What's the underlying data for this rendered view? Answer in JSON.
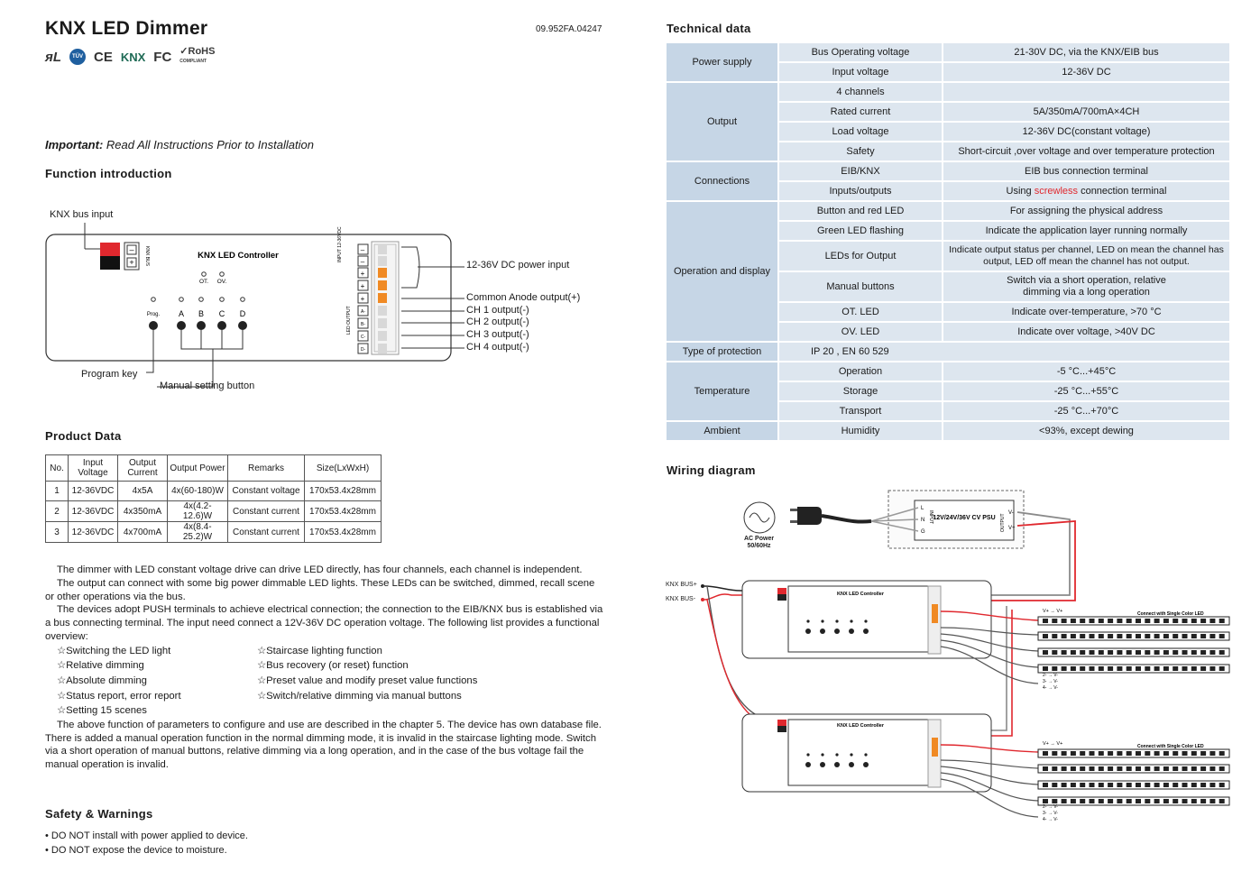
{
  "header": {
    "title": "KNX LED Dimmer",
    "doc_number": "09.952FA.04247",
    "certs": [
      "UL",
      "TÜV",
      "CE",
      "KNX",
      "FC",
      "RoHS"
    ]
  },
  "important": {
    "label": "Important:",
    "text": "Read All Instructions Prior to Installation"
  },
  "function_intro": {
    "heading": "Function introduction",
    "knx_bus_input": "KNX bus input",
    "controller_title": "KNX LED Controller",
    "ot": "OT.",
    "ov": "OV.",
    "prog": "Prog.",
    "buttons": [
      "A",
      "B",
      "C",
      "D"
    ],
    "power_input": "12-36V DC power input",
    "common_anode": "Common Anode output(+)",
    "ch_outputs": [
      "CH 1 output(-)",
      "CH 2 output(-)",
      "CH 3 output(-)",
      "CH 4 output(-)"
    ],
    "program_key": "Program key",
    "manual_button": "Manual setting button",
    "knx_bus_side": "KNX BUS",
    "input_side": "INPUT 12-36VDC",
    "led_output_side": "LED OUTPUT",
    "term_out": [
      "A-",
      "B-",
      "C-",
      "D-"
    ]
  },
  "product_data": {
    "heading": "Product Data",
    "columns": [
      "No.",
      "Input Voltage",
      "Output Current",
      "Output Power",
      "Remarks",
      "Size(LxWxH)"
    ],
    "rows": [
      [
        "1",
        "12-36VDC",
        "4x5A",
        "4x(60-180)W",
        "Constant voltage",
        "170x53.4x28mm"
      ],
      [
        "2",
        "12-36VDC",
        "4x350mA",
        "4x(4.2-12.6)W",
        "Constant current",
        "170x53.4x28mm"
      ],
      [
        "3",
        "12-36VDC",
        "4x700mA",
        "4x(8.4-25.2)W",
        "Constant current",
        "170x53.4x28mm"
      ]
    ]
  },
  "description": {
    "p1": "The dimmer with LED constant voltage drive can drive LED directly, has four channels, each channel is independent.",
    "p2": "The output can connect with some big power dimmable LED lights. These LEDs can be switched, dimmed, recall scene or other operations via the bus.",
    "p3": "The devices adopt PUSH terminals to achieve electrical connection; the connection to the EIB/KNX bus is established via a bus connecting terminal. The input need connect a 12V-36V DC operation voltage. The following list provides a functional overview:",
    "features": [
      "☆Switching the LED light",
      "☆Staircase lighting function",
      "☆Relative dimming",
      "☆Bus recovery (or reset) function",
      "☆Absolute dimming",
      "☆Preset value and modify preset value functions",
      "☆Status report, error report",
      "☆Switch/relative dimming via manual buttons",
      "☆Setting 15 scenes",
      ""
    ],
    "p4": "The above function of parameters to configure and use are described in the chapter 5. The device has own database file. There is added a manual operation function in the normal dimming mode, it is invalid in the staircase lighting mode. Switch via a short operation of manual buttons, relative dimming via a long operation, and in the case of the bus voltage fail the manual operation is invalid."
  },
  "safety": {
    "heading": "Safety & Warnings",
    "items": [
      "• DO NOT install with power applied to device.",
      "• DO NOT expose the device to moisture."
    ]
  },
  "technical": {
    "heading": "Technical data",
    "groups": [
      {
        "category": "Power supply",
        "rows": [
          [
            "Bus Operating voltage",
            "21-30V DC, via the KNX/EIB bus"
          ],
          [
            "Input voltage",
            "12-36V DC"
          ]
        ]
      },
      {
        "category": "Output",
        "rows": [
          [
            "4 channels",
            ""
          ],
          [
            "Rated current",
            "5A/350mA/700mA×4CH"
          ],
          [
            "Load voltage",
            "12-36V DC(constant voltage)"
          ],
          [
            "Safety",
            "Short-circuit ,over voltage and over temperature protection"
          ]
        ]
      },
      {
        "category": "Connections",
        "rows": [
          [
            "EIB/KNX",
            "EIB bus connection terminal"
          ],
          [
            "Inputs/outputs",
            "Using screwless connection terminal"
          ]
        ]
      },
      {
        "category": "Operation and display",
        "rows": [
          [
            "Button and red LED",
            "For assigning the physical address"
          ],
          [
            "Green LED flashing",
            "Indicate the application layer running normally"
          ],
          [
            "LEDs for Output",
            "Indicate output status per channel, LED on mean the channel has output, LED off mean the channel has not output."
          ],
          [
            "Manual buttons",
            "Switch via a short operation, relative dimming via a long operation"
          ],
          [
            "OT. LED",
            "Indicate over-temperature, >70 °C"
          ],
          [
            "OV. LED",
            "Indicate over voltage, >40V DC"
          ]
        ]
      },
      {
        "category": "Type of protection",
        "rows": [
          [
            "IP 20 , EN 60 529",
            ""
          ]
        ]
      },
      {
        "category": "Temperature",
        "rows": [
          [
            "Operation",
            "-5 °C...+45°C"
          ],
          [
            "Storage",
            "-25 °C...+55°C"
          ],
          [
            "Transport",
            "-25 °C...+70°C"
          ]
        ]
      },
      {
        "category": "Ambient",
        "rows": [
          [
            "Humidity",
            "<93%, except dewing"
          ]
        ]
      }
    ],
    "using": "Using ",
    "screwless": "screwless",
    "conn_terminal": " connection terminal"
  },
  "wiring": {
    "heading": "Wiring diagram",
    "ac_power": "AC Power",
    "ac_freq": "50/60Hz",
    "psu_label": "12V/24V/36V CV PSU",
    "psu_input": "INPUT",
    "psu_output": "OUTPUT",
    "psu_lng": [
      "L",
      "N",
      "G"
    ],
    "psu_v": [
      "V-",
      "V+"
    ],
    "knx_bus_plus": "KNX BUS+",
    "knx_bus_minus": "KNX BUS-",
    "controller": "KNX LED Controller",
    "strip_label": "Connect with Single Color LED",
    "strip_v": [
      "V+",
      "→",
      "V+"
    ],
    "strip_rows": [
      "1-",
      "2-",
      "3-",
      "4-"
    ],
    "strip_vminus": "V-",
    "colors": {
      "red_wire": "#e0282e",
      "gray_wire": "#8a8a8a",
      "table_cell": "#dde6ef",
      "table_cat": "#c6d6e6",
      "terminal_orange": "#f08a24"
    }
  }
}
